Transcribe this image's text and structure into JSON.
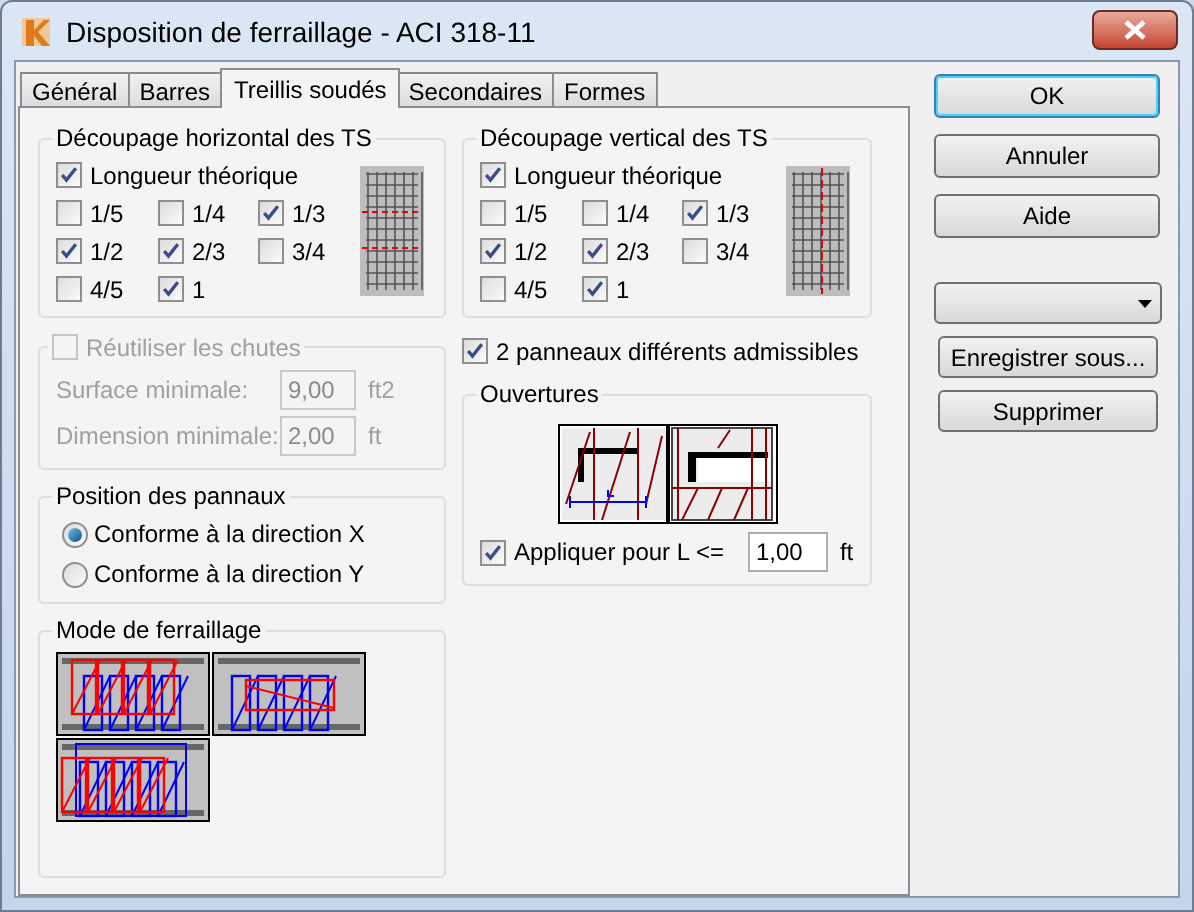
{
  "window": {
    "title": "Disposition de ferraillage - ACI 318-11"
  },
  "tabs": [
    {
      "label": "Général",
      "selected": false
    },
    {
      "label": "Barres",
      "selected": false
    },
    {
      "label": "Treillis soudés",
      "selected": true
    },
    {
      "label": "Secondaires",
      "selected": false
    },
    {
      "label": "Formes",
      "selected": false
    }
  ],
  "horizontal_cut": {
    "title": "Découpage horizontal des TS",
    "main": {
      "label": "Longueur théorique",
      "checked": true
    },
    "fractions": [
      {
        "label": "1/5",
        "checked": false
      },
      {
        "label": "1/4",
        "checked": false
      },
      {
        "label": "1/3",
        "checked": true
      },
      {
        "label": "1/2",
        "checked": true
      },
      {
        "label": "2/3",
        "checked": true
      },
      {
        "label": "3/4",
        "checked": false
      },
      {
        "label": "4/5",
        "checked": false
      },
      {
        "label": "1",
        "checked": true
      }
    ]
  },
  "reuse_offcuts": {
    "label": "Réutiliser les chutes",
    "checked": false,
    "disabled": true,
    "fields": [
      {
        "label": "Surface minimale:",
        "value": "9,00",
        "unit": "ft2"
      },
      {
        "label": "Dimension minimale:",
        "value": "2,00",
        "unit": "ft"
      }
    ]
  },
  "panel_position": {
    "title": "Position des pannaux",
    "options": [
      {
        "label": "Conforme à la direction X",
        "selected": true
      },
      {
        "label": "Conforme à la direction Y",
        "selected": false
      }
    ]
  },
  "reinforcement_mode": {
    "title": "Mode de ferraillage"
  },
  "vertical_cut": {
    "title": "Découpage vertical des TS",
    "main": {
      "label": "Longueur théorique",
      "checked": true
    },
    "fractions": [
      {
        "label": "1/5",
        "checked": false
      },
      {
        "label": "1/4",
        "checked": false
      },
      {
        "label": "1/3",
        "checked": true
      },
      {
        "label": "1/2",
        "checked": true
      },
      {
        "label": "2/3",
        "checked": true
      },
      {
        "label": "3/4",
        "checked": false
      },
      {
        "label": "4/5",
        "checked": false
      },
      {
        "label": "1",
        "checked": true
      }
    ]
  },
  "two_panels": {
    "label": "2 panneaux différents admissibles",
    "checked": true
  },
  "openings": {
    "title": "Ouvertures",
    "apply": {
      "label": "Appliquer pour L <=",
      "checked": true,
      "value": "1,00",
      "unit": "ft"
    }
  },
  "buttons": [
    {
      "label": "OK",
      "default": true
    },
    {
      "label": "Annuler",
      "default": false
    },
    {
      "label": "Aide",
      "default": false
    }
  ],
  "side_buttons": [
    "Enregistrer sous...",
    "Supprimer"
  ]
}
